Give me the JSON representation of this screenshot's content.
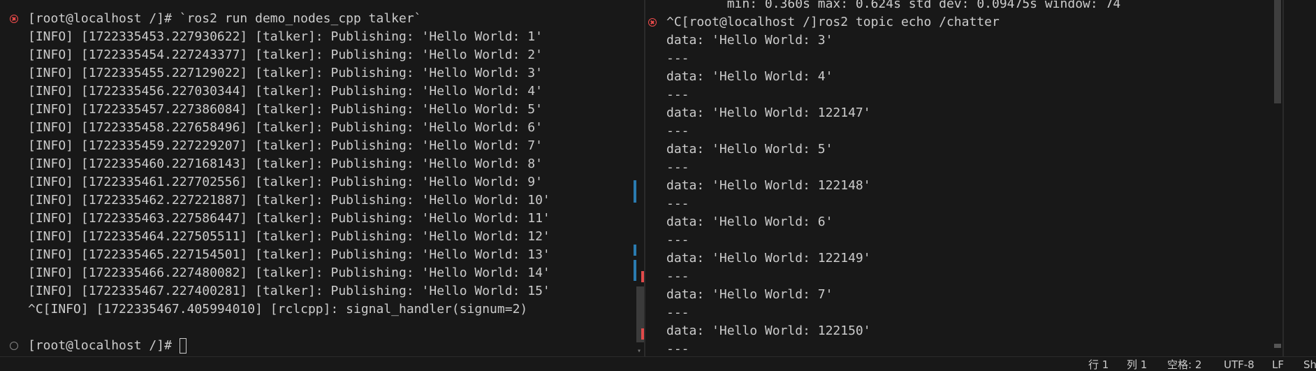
{
  "left_terminal": {
    "lines": [
      {
        "text": "[root@localhost /]# `ros2 run demo_nodes_cpp talker`",
        "decoration": "error"
      },
      {
        "text": "[INFO] [1722335453.227930622] [talker]: Publishing: 'Hello World: 1'",
        "decoration": ""
      },
      {
        "text": "[INFO] [1722335454.227243377] [talker]: Publishing: 'Hello World: 2'",
        "decoration": ""
      },
      {
        "text": "[INFO] [1722335455.227129022] [talker]: Publishing: 'Hello World: 3'",
        "decoration": ""
      },
      {
        "text": "[INFO] [1722335456.227030344] [talker]: Publishing: 'Hello World: 4'",
        "decoration": ""
      },
      {
        "text": "[INFO] [1722335457.227386084] [talker]: Publishing: 'Hello World: 5'",
        "decoration": ""
      },
      {
        "text": "[INFO] [1722335458.227658496] [talker]: Publishing: 'Hello World: 6'",
        "decoration": ""
      },
      {
        "text": "[INFO] [1722335459.227229207] [talker]: Publishing: 'Hello World: 7'",
        "decoration": ""
      },
      {
        "text": "[INFO] [1722335460.227168143] [talker]: Publishing: 'Hello World: 8'",
        "decoration": ""
      },
      {
        "text": "[INFO] [1722335461.227702556] [talker]: Publishing: 'Hello World: 9'",
        "decoration": ""
      },
      {
        "text": "[INFO] [1722335462.227221887] [talker]: Publishing: 'Hello World: 10'",
        "decoration": ""
      },
      {
        "text": "[INFO] [1722335463.227586447] [talker]: Publishing: 'Hello World: 11'",
        "decoration": ""
      },
      {
        "text": "[INFO] [1722335464.227505511] [talker]: Publishing: 'Hello World: 12'",
        "decoration": ""
      },
      {
        "text": "[INFO] [1722335465.227154501] [talker]: Publishing: 'Hello World: 13'",
        "decoration": ""
      },
      {
        "text": "[INFO] [1722335466.227480082] [talker]: Publishing: 'Hello World: 14'",
        "decoration": ""
      },
      {
        "text": "[INFO] [1722335467.227400281] [talker]: Publishing: 'Hello World: 15'",
        "decoration": ""
      },
      {
        "text": "^C[INFO] [1722335467.405994010] [rclcpp]: signal_handler(signum=2)",
        "decoration": ""
      },
      {
        "text": "",
        "decoration": ""
      },
      {
        "text": "[root@localhost /]# ",
        "decoration": "ok",
        "cursor": true
      }
    ]
  },
  "right_terminal": {
    "lines": [
      {
        "text": "        min: 0.360s max: 0.624s std dev: 0.09475s window: 74",
        "decoration": ""
      },
      {
        "text": "^C[root@localhost /]ros2 topic echo /chatter",
        "decoration": "error"
      },
      {
        "text": "data: 'Hello World: 3'",
        "decoration": ""
      },
      {
        "text": "---",
        "decoration": ""
      },
      {
        "text": "data: 'Hello World: 4'",
        "decoration": ""
      },
      {
        "text": "---",
        "decoration": ""
      },
      {
        "text": "data: 'Hello World: 122147'",
        "decoration": ""
      },
      {
        "text": "---",
        "decoration": ""
      },
      {
        "text": "data: 'Hello World: 5'",
        "decoration": ""
      },
      {
        "text": "---",
        "decoration": ""
      },
      {
        "text": "data: 'Hello World: 122148'",
        "decoration": ""
      },
      {
        "text": "---",
        "decoration": ""
      },
      {
        "text": "data: 'Hello World: 6'",
        "decoration": ""
      },
      {
        "text": "---",
        "decoration": ""
      },
      {
        "text": "data: 'Hello World: 122149'",
        "decoration": ""
      },
      {
        "text": "---",
        "decoration": ""
      },
      {
        "text": "data: 'Hello World: 7'",
        "decoration": ""
      },
      {
        "text": "---",
        "decoration": ""
      },
      {
        "text": "data: 'Hello World: 122150'",
        "decoration": ""
      },
      {
        "text": "---",
        "decoration": ""
      }
    ]
  },
  "status_bar": {
    "line": "行 1",
    "column": "列 1",
    "indent": "空格: 2",
    "encoding": "UTF-8",
    "eol": "LF",
    "language": "Sh"
  },
  "colors": {
    "background": "#181818",
    "text": "#cccccc",
    "error_decoration": "#f14c4c",
    "ok_decoration": "#858585",
    "ruler_blue": "#2a7bb0",
    "ruler_red": "#e04a4a"
  }
}
